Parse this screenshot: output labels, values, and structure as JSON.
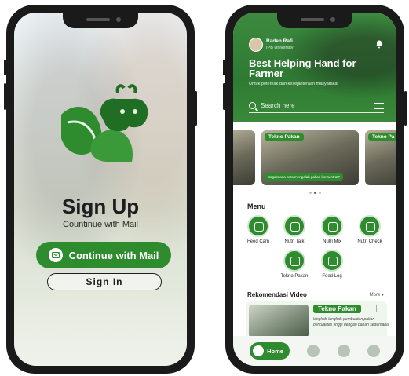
{
  "left_screen": {
    "title": "Sign Up",
    "subtitle": "Countinue with Mail",
    "continue_button": "Continue with Mail",
    "signin_button": "Sign In"
  },
  "right_screen": {
    "user_name": "Raden Rafi",
    "user_org": "IPB University",
    "hero_title": "Best Helping Hand for Farmer",
    "hero_subtitle": "Untuk peternak dan kesejahteraan masyarakat",
    "search_placeholder": "Search here",
    "carousel": [
      {
        "tag": "Tekno Pakan",
        "caption": "Bagaimana cara mengolah pakan konsentrat?"
      },
      {
        "tag": "Tekno Pa"
      }
    ],
    "menu_title": "Menu",
    "menu_items": [
      {
        "label": "Feed Cam",
        "icon": "camera-icon"
      },
      {
        "label": "Nutri Talk",
        "icon": "chat-icon"
      },
      {
        "label": "Nutri Mix",
        "icon": "mix-icon"
      },
      {
        "label": "Nutri Check",
        "icon": "check-icon"
      },
      {
        "label": "Tekno Pakan",
        "icon": "book-icon"
      },
      {
        "label": "Feed Log",
        "icon": "log-icon"
      }
    ],
    "rekomendasi_title": "Rekomendasi Video",
    "more_label": "More",
    "video": {
      "tag": "Tekno Pakan",
      "description": "langkah-langkah pembuatan pakan berkualitas tinggi dengan bahan sederhana"
    },
    "nav": {
      "home": "Home"
    }
  },
  "colors": {
    "brand_green": "#2e8b2e"
  }
}
